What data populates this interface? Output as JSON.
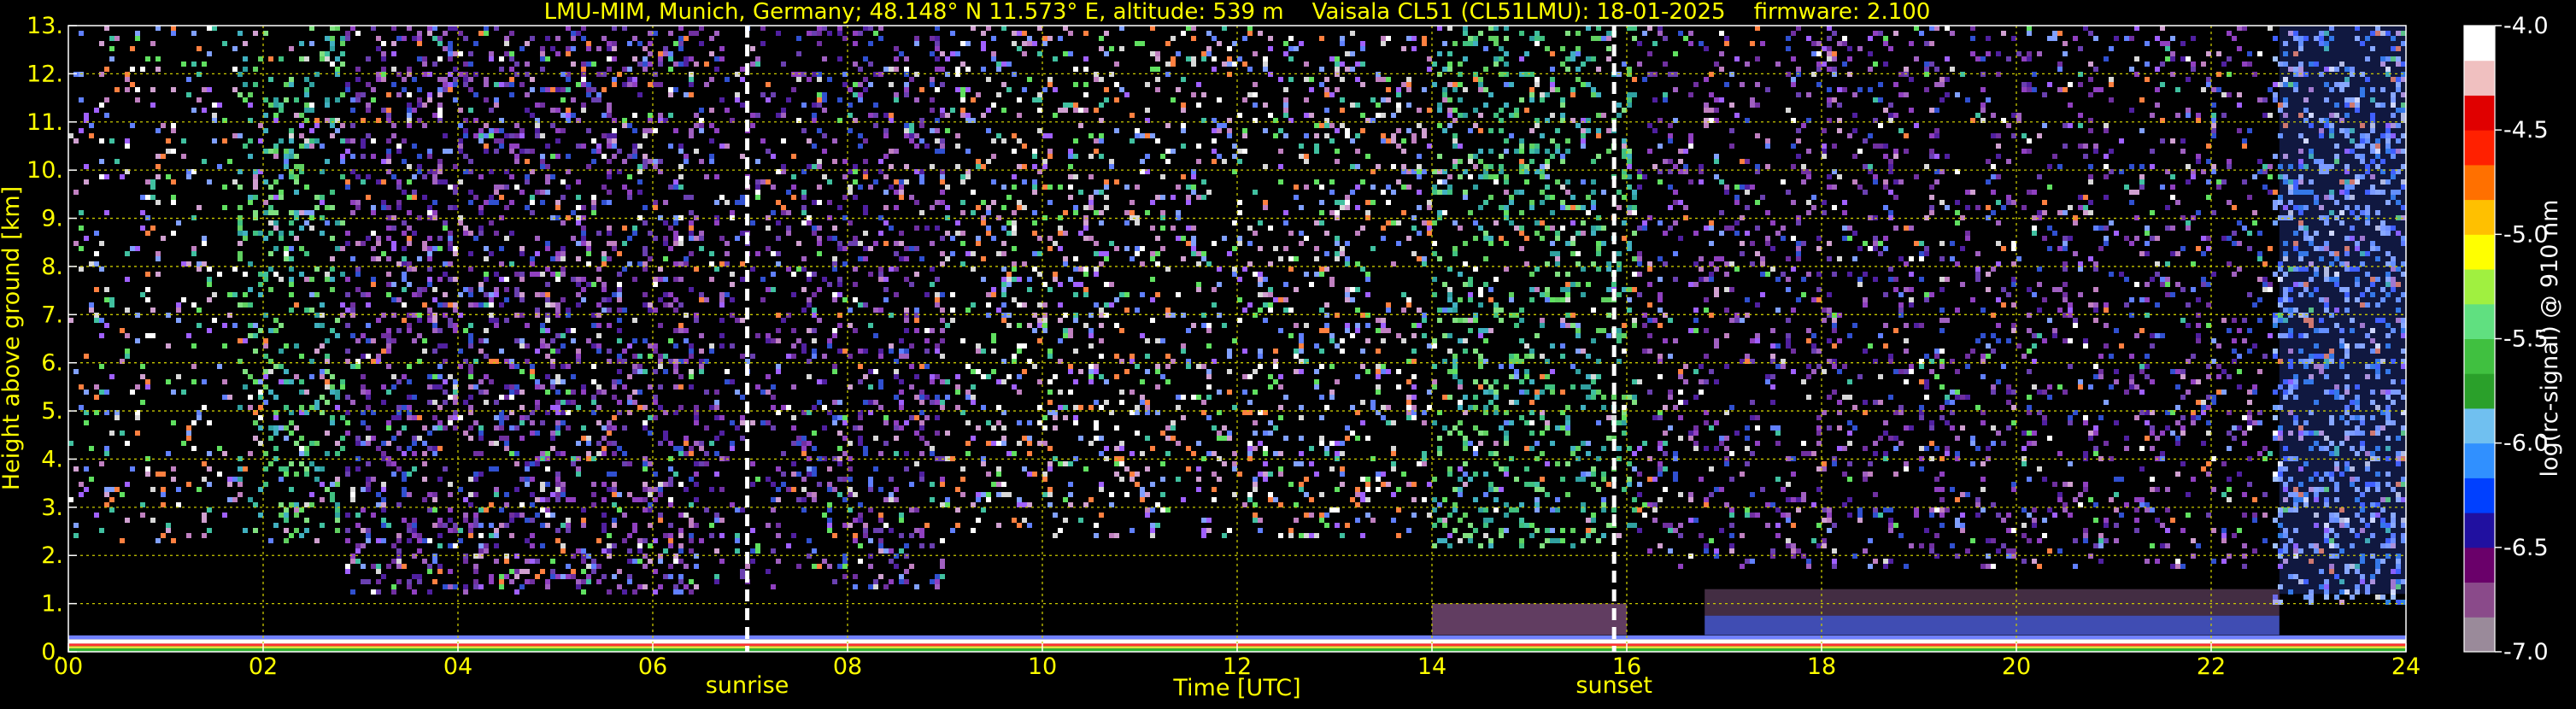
{
  "chart_data": {
    "type": "heatmap",
    "title": "LMU-MIM, Munich, Germany; 48.148° N 11.573° E, altitude: 539 m    Vaisala CL51 (CL51LMU): 18-01-2025    firmware: 2.100",
    "xlabel": "Time [UTC]",
    "ylabel": "Height above ground [km]",
    "colorbar_label": "log(rc-signal) @ 910 nm",
    "xlim": [
      0,
      24
    ],
    "ylim": [
      0,
      13
    ],
    "clim": [
      -7.0,
      -4.0
    ],
    "grid": true,
    "x_ticks": [
      "00",
      "02",
      "04",
      "06",
      "08",
      "10",
      "12",
      "14",
      "16",
      "18",
      "20",
      "22",
      "24"
    ],
    "x_tick_values": [
      0,
      2,
      4,
      6,
      8,
      10,
      12,
      14,
      16,
      18,
      20,
      22,
      24
    ],
    "y_ticks": [
      "0.",
      "1.",
      "2.",
      "3.",
      "4.",
      "5.",
      "6.",
      "7.",
      "8.",
      "9.",
      "10.",
      "11.",
      "12.",
      "13."
    ],
    "y_tick_values": [
      0,
      1,
      2,
      3,
      4,
      5,
      6,
      7,
      8,
      9,
      10,
      11,
      12,
      13
    ],
    "colorbar_ticks": [
      "-4.0",
      "-4.5",
      "-5.0",
      "-5.5",
      "-6.0",
      "-6.5",
      "-7.0"
    ],
    "colorbar_tick_values": [
      -4.0,
      -4.5,
      -5.0,
      -5.5,
      -6.0,
      -6.5,
      -7.0
    ],
    "markers": [
      {
        "label": "sunrise",
        "time": 6.97
      },
      {
        "label": "sunset",
        "time": 15.87
      }
    ],
    "colormap": [
      "#9a8a9a",
      "#8a4a8a",
      "#6a006a",
      "#2010a0",
      "#0040ff",
      "#3090ff",
      "#70c0f0",
      "#2aa02a",
      "#40c040",
      "#60e080",
      "#a0f040",
      "#ffff00",
      "#ffc000",
      "#ff7000",
      "#ff2000",
      "#e00000",
      "#f0c0c0",
      "#ffffff"
    ],
    "colors": {
      "background": "#000000",
      "text": "#ffff00",
      "grid": "#c8c800",
      "marker": "#ffffff",
      "colorbar_text": "#ffffff"
    }
  }
}
